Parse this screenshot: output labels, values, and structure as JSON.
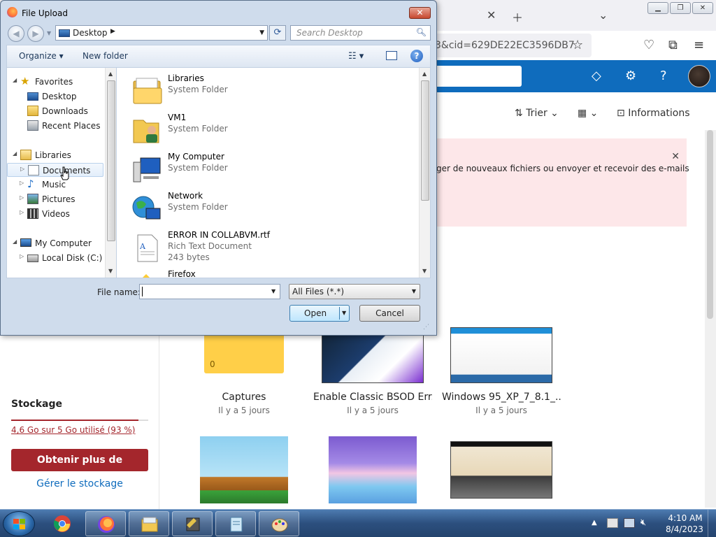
{
  "browser": {
    "url_fragment": "3&cid=629DE22EC3596DB7",
    "trier_label": "Trier",
    "informations_label": "Informations",
    "alert_text": "ger de nouveaux fichiers ou envoyer et recevoir des e-mails",
    "storage": {
      "title": "Stockage",
      "used_text": "4,6 Go sur 5 Go utilisé (93 %)",
      "used_fraction": 0.93,
      "get_more_label": "Obtenir plus de stockage",
      "manage_label": "Gérer le stockage"
    },
    "tiles": [
      {
        "name": "Captures",
        "date": "Il y a 5 jours",
        "count": "0",
        "kind": "folder"
      },
      {
        "name": "Enable Classic BSOD Err...",
        "date": "Il y a 5 jours",
        "kind": "image"
      },
      {
        "name": "Windows 95_XP_7_8.1_...",
        "date": "Il y a 5 jours",
        "kind": "image"
      },
      {
        "kind": "image"
      },
      {
        "kind": "image"
      },
      {
        "kind": "image"
      }
    ],
    "colors": {
      "accent": "#0f6cbd",
      "alert_bg": "#fde7e9",
      "storage_red": "#a4262c",
      "folder_yellow": "#ffcf48"
    }
  },
  "dialog": {
    "title": "File Upload",
    "address": "Desktop",
    "search_placeholder": "Search Desktop",
    "toolbar": {
      "organize_label": "Organize",
      "new_folder_label": "New folder"
    },
    "nav": {
      "favorites_label": "Favorites",
      "favorites": [
        "Desktop",
        "Downloads",
        "Recent Places"
      ],
      "libraries_label": "Libraries",
      "libraries": [
        "Documents",
        "Music",
        "Pictures",
        "Videos"
      ],
      "computer_label": "My Computer",
      "computer": [
        "Local Disk (C:)"
      ]
    },
    "files": [
      {
        "name": "Libraries",
        "type": "System Folder",
        "icon": "libraries-icon"
      },
      {
        "name": "VM1",
        "type": "System Folder",
        "icon": "user-folder-icon"
      },
      {
        "name": "My Computer",
        "type": "System Folder",
        "icon": "computer-icon"
      },
      {
        "name": "Network",
        "type": "System Folder",
        "icon": "network-icon"
      },
      {
        "name": "ERROR IN COLLABVM.rtf",
        "type": "Rich Text Document",
        "size": "243 bytes",
        "icon": "rtf-document-icon"
      },
      {
        "name": "Firefox",
        "type": "",
        "icon": "firefox-shortcut-icon"
      }
    ],
    "file_name_label": "File name:",
    "file_name_value": "",
    "filter_value": "All Files (*.*)",
    "open_label": "Open",
    "cancel_label": "Cancel"
  },
  "taskbar": {
    "apps": [
      "chrome-icon",
      "firefox-icon",
      "explorer-icon",
      "vm-tool-icon",
      "notepad-icon",
      "paint-icon"
    ],
    "time": "4:10 AM",
    "date": "8/4/2023"
  }
}
